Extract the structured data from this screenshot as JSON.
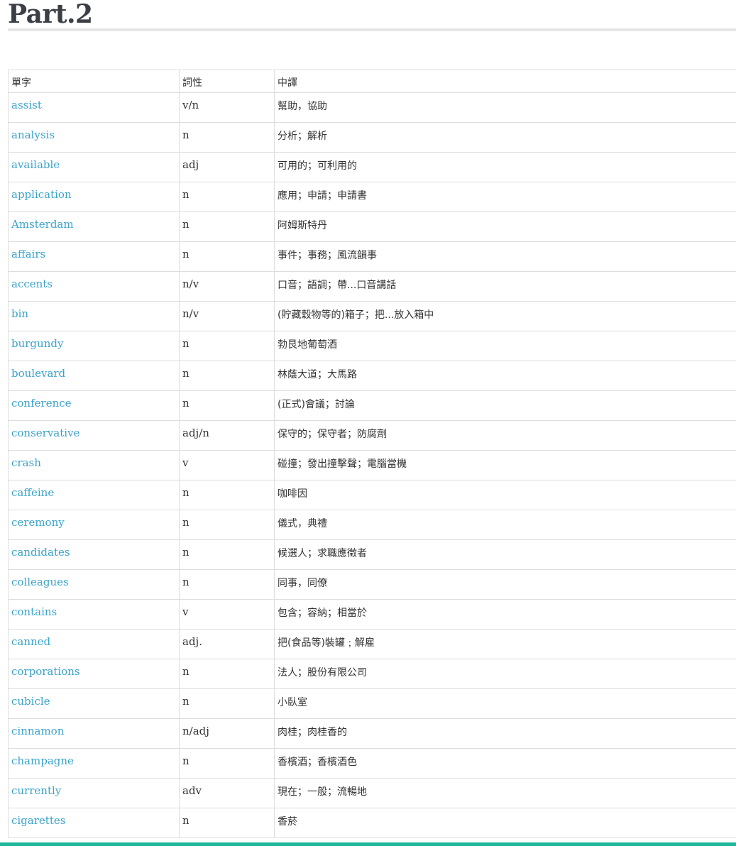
{
  "page": {
    "title": "Part.2"
  },
  "table": {
    "headers": [
      "單字",
      "詞性",
      "中譯"
    ],
    "rows": [
      {
        "word": "assist",
        "pos": "v/n",
        "meaning": "幫助，協助"
      },
      {
        "word": "analysis",
        "pos": "n",
        "meaning": "分析；解析"
      },
      {
        "word": "available",
        "pos": "adj",
        "meaning": "可用的；可利用的"
      },
      {
        "word": "application",
        "pos": "n",
        "meaning": "應用；申請；申請書"
      },
      {
        "word": "Amsterdam",
        "pos": "n",
        "meaning": "阿姆斯特丹"
      },
      {
        "word": "affairs",
        "pos": "n",
        "meaning": "事件；事務；風流韻事"
      },
      {
        "word": "accents",
        "pos": "n/v",
        "meaning": "口音；語調；帶...口音講話"
      },
      {
        "word": "bin",
        "pos": "n/v",
        "meaning": "(貯藏穀物等的)箱子；把...放入箱中"
      },
      {
        "word": "burgundy",
        "pos": "n",
        "meaning": "勃艮地葡萄酒"
      },
      {
        "word": "boulevard",
        "pos": "n",
        "meaning": "林蔭大道；大馬路"
      },
      {
        "word": "conference",
        "pos": "n",
        "meaning": "(正式)會議；討論"
      },
      {
        "word": "conservative",
        "pos": "adj/n",
        "meaning": "保守的；保守者；防腐劑"
      },
      {
        "word": "crash",
        "pos": "v",
        "meaning": "碰撞；發出撞擊聲；電腦當機"
      },
      {
        "word": "caffeine",
        "pos": "n",
        "meaning": "咖啡因"
      },
      {
        "word": "ceremony",
        "pos": "n",
        "meaning": "儀式，典禮"
      },
      {
        "word": "candidates",
        "pos": "n",
        "meaning": "候選人；求職應徵者"
      },
      {
        "word": "colleagues",
        "pos": "n",
        "meaning": "同事，同僚"
      },
      {
        "word": "contains",
        "pos": "v",
        "meaning": "包含；容納；相當於"
      },
      {
        "word": "canned",
        "pos": "adj.",
        "meaning": "把(食品等)裝罐﹔解雇"
      },
      {
        "word": "corporations",
        "pos": "n",
        "meaning": "法人；股份有限公司"
      },
      {
        "word": "cubicle",
        "pos": "n",
        "meaning": "小臥室"
      },
      {
        "word": "cinnamon",
        "pos": "n/adj",
        "meaning": "肉桂；肉桂香的"
      },
      {
        "word": "champagne",
        "pos": "n",
        "meaning": "香檳酒；香檳酒色"
      },
      {
        "word": "currently",
        "pos": "adv",
        "meaning": "現在；一般；流暢地"
      },
      {
        "word": "cigarettes",
        "pos": "n",
        "meaning": "香菸"
      }
    ]
  },
  "colors": {
    "link": "#3aa3c9",
    "heading": "#3b3f45",
    "accent_bar": "#1fb59a",
    "border": "#dddddd"
  }
}
